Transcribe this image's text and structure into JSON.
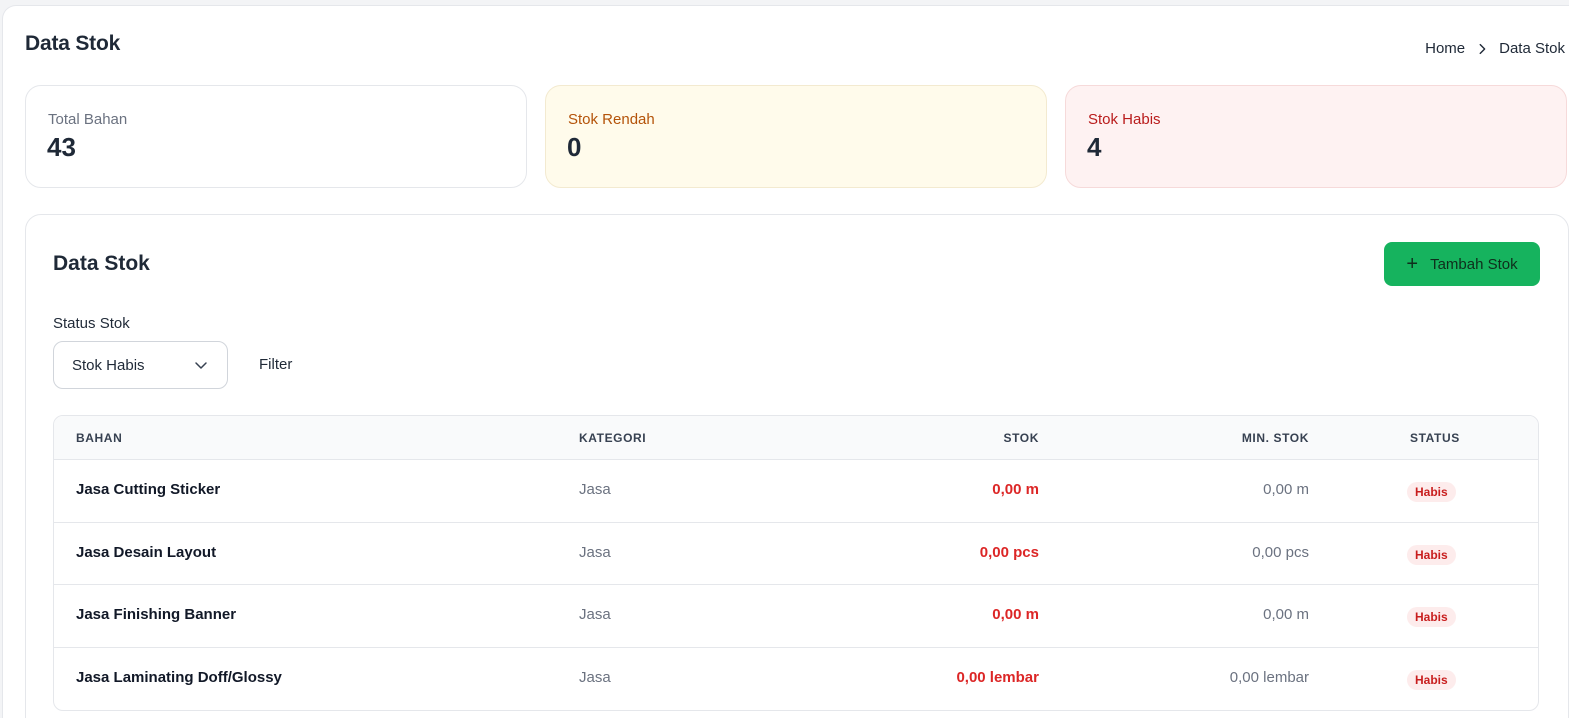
{
  "header": {
    "title": "Data Stok",
    "breadcrumb": [
      "Home",
      "Data Stok"
    ]
  },
  "summary": [
    {
      "label": "Total Bahan",
      "value": "43",
      "tone": "neutral"
    },
    {
      "label": "Stok Rendah",
      "value": "0",
      "tone": "warning"
    },
    {
      "label": "Stok Habis",
      "value": "4",
      "tone": "danger"
    }
  ],
  "panel": {
    "title": "Data Stok",
    "add_button_label": "Tambah Stok",
    "filter": {
      "label": "Status Stok",
      "selected": "Stok Habis",
      "button_label": "Filter"
    }
  },
  "table": {
    "columns": [
      "BAHAN",
      "KATEGORI",
      "STOK",
      "MIN. STOK",
      "STATUS"
    ],
    "rows": [
      {
        "bahan": "Jasa Cutting Sticker",
        "kategori": "Jasa",
        "stok": "0,00 m",
        "min_stok": "0,00 m",
        "status": "Habis"
      },
      {
        "bahan": "Jasa Desain Layout",
        "kategori": "Jasa",
        "stok": "0,00 pcs",
        "min_stok": "0,00 pcs",
        "status": "Habis"
      },
      {
        "bahan": "Jasa Finishing Banner",
        "kategori": "Jasa",
        "stok": "0,00 m",
        "min_stok": "0,00 m",
        "status": "Habis"
      },
      {
        "bahan": "Jasa Laminating Doff/Glossy",
        "kategori": "Jasa",
        "stok": "0,00 lembar",
        "min_stok": "0,00 lembar",
        "status": "Habis"
      }
    ]
  },
  "colors": {
    "accent_green": "#16b35e",
    "danger_red": "#dc2626",
    "warning_bg": "#fffbeb",
    "danger_bg": "#fef2f2"
  },
  "icons": {
    "breadcrumb_separator": "chevron-right-icon",
    "select_caret": "chevron-down-icon",
    "add": "plus-icon"
  }
}
